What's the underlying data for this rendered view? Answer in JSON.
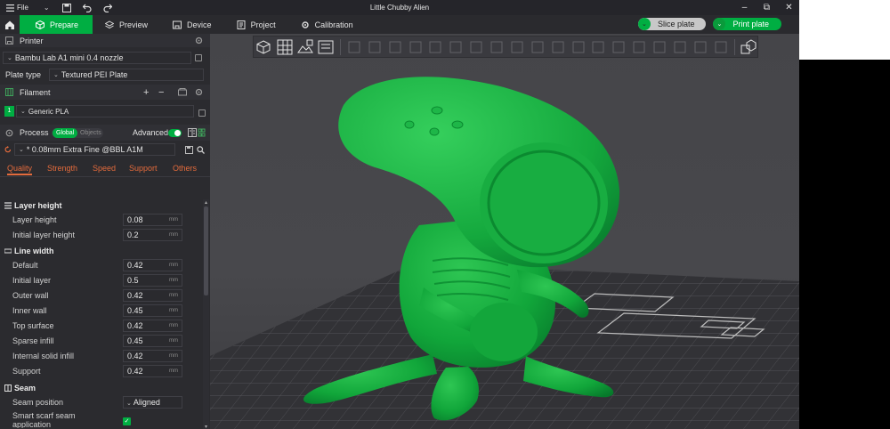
{
  "window": {
    "title": "Little Chubby Alien",
    "file_menu": "File"
  },
  "tabs": [
    {
      "label": "Prepare",
      "icon": "cube-plus-icon",
      "active": true
    },
    {
      "label": "Preview",
      "icon": "layers-icon",
      "active": false
    },
    {
      "label": "Device",
      "icon": "printer-icon",
      "active": false
    },
    {
      "label": "Project",
      "icon": "document-icon",
      "active": false
    },
    {
      "label": "Calibration",
      "icon": "gear-icon",
      "active": false
    }
  ],
  "actions": {
    "slice": "Slice plate",
    "print": "Print plate"
  },
  "printer": {
    "section": "Printer",
    "model": "Bambu Lab A1 mini 0.4 nozzle",
    "plate_type_label": "Plate type",
    "plate_type": "Textured PEI Plate"
  },
  "filament": {
    "section": "Filament",
    "slot": "1",
    "name": "Generic PLA"
  },
  "process": {
    "section": "Process",
    "global": "Global",
    "objects": "Objects",
    "advanced": "Advanced",
    "preset": "* 0.08mm Extra Fine @BBL A1M",
    "tabs": [
      "Quality",
      "Strength",
      "Speed",
      "Support",
      "Others"
    ]
  },
  "groups": {
    "layer_height": {
      "title": "Layer height",
      "params": [
        {
          "label": "Layer height",
          "value": "0.08",
          "unit": "mm"
        },
        {
          "label": "Initial layer height",
          "value": "0.2",
          "unit": "mm"
        }
      ]
    },
    "line_width": {
      "title": "Line width",
      "params": [
        {
          "label": "Default",
          "value": "0.42",
          "unit": "mm"
        },
        {
          "label": "Initial layer",
          "value": "0.5",
          "unit": "mm"
        },
        {
          "label": "Outer wall",
          "value": "0.42",
          "unit": "mm"
        },
        {
          "label": "Inner wall",
          "value": "0.45",
          "unit": "mm"
        },
        {
          "label": "Top surface",
          "value": "0.42",
          "unit": "mm"
        },
        {
          "label": "Sparse infill",
          "value": "0.45",
          "unit": "mm"
        },
        {
          "label": "Internal solid infill",
          "value": "0.42",
          "unit": "mm"
        },
        {
          "label": "Support",
          "value": "0.42",
          "unit": "mm"
        }
      ]
    },
    "seam": {
      "title": "Seam",
      "seam_position_label": "Seam position",
      "seam_position": "Aligned",
      "smart_scarf_label_1": "Smart scarf seam",
      "smart_scarf_label_2": "application"
    }
  },
  "colors": {
    "accent": "#00ae42",
    "tab_orange": "#e46b3c",
    "model_green": "#0ea33a"
  }
}
